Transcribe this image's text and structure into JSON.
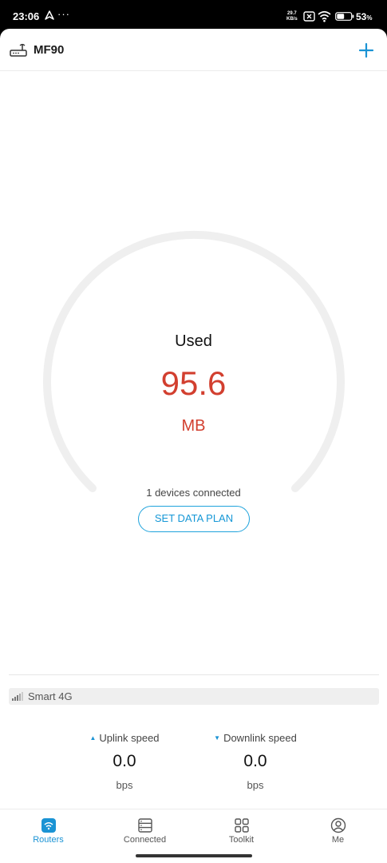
{
  "status_bar": {
    "time": "23:06",
    "dots": "···",
    "net_speed_value": "29.7",
    "net_speed_unit": "KB/s",
    "battery_percent": "53",
    "battery_unit": "%",
    "battery_level": 0.53
  },
  "header": {
    "router_name": "MF90",
    "add_icon": "plus-icon",
    "router_icon": "router-icon"
  },
  "usage": {
    "label": "Used",
    "value": "95.6",
    "unit": "MB",
    "devices_text": "1 devices connected",
    "set_plan_label": "SET DATA PLAN"
  },
  "network": {
    "name": "Smart 4G",
    "icon": "signal-bars-icon"
  },
  "speeds": {
    "uplink": {
      "label": "Uplink speed",
      "value": "0.0",
      "unit": "bps"
    },
    "downlink": {
      "label": "Downlink speed",
      "value": "0.0",
      "unit": "bps"
    }
  },
  "tabs": [
    {
      "label": "Routers",
      "icon": "wifi-router-icon",
      "active": true
    },
    {
      "label": "Connected",
      "icon": "list-icon",
      "active": false
    },
    {
      "label": "Toolkit",
      "icon": "grid-icon",
      "active": false
    },
    {
      "label": "Me",
      "icon": "user-icon",
      "active": false
    }
  ],
  "colors": {
    "accent": "#1a93d4",
    "usage_red": "#d23f2f",
    "gauge_track": "#efefef"
  }
}
